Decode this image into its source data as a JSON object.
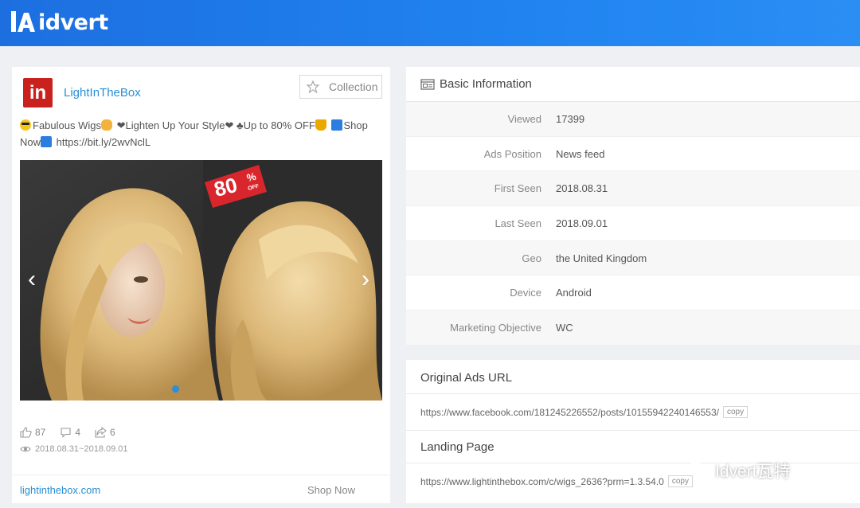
{
  "header": {
    "logo_text": "idvert"
  },
  "ad": {
    "advertiser_name": "LightInTheBox",
    "avatar_text": "in",
    "collection_label": "Collection",
    "text_part1": "Fabulous Wigs",
    "text_part2": "❤Lighten Up Your Style❤ ♣Up to 80% OFF",
    "text_part3": "Shop",
    "text_part4": "Now",
    "text_part5": "https://bit.ly/2wvNclL",
    "image_badge_big": "80",
    "image_badge_pct": "%",
    "image_badge_off": "OFF",
    "likes": "87",
    "comments": "4",
    "shares": "6",
    "date_range": "2018.08.31~2018.09.01",
    "domain": "lightinthebox.com",
    "cta": "Shop Now",
    "prev_arrow": "‹",
    "next_arrow": "›"
  },
  "basic_info": {
    "title": "Basic Information",
    "rows": [
      {
        "key": "Viewed",
        "value": "17399"
      },
      {
        "key": "Ads Position",
        "value": "News feed"
      },
      {
        "key": "First Seen",
        "value": "2018.08.31"
      },
      {
        "key": "Last Seen",
        "value": "2018.09.01"
      },
      {
        "key": "Geo",
        "value": "the United Kingdom"
      },
      {
        "key": "Device",
        "value": "Android"
      },
      {
        "key": "Marketing Objective",
        "value": "WC"
      }
    ]
  },
  "original_url": {
    "title": "Original Ads URL",
    "url": "https://www.facebook.com/181245226552/posts/10155942240146553/",
    "copy_label": "copy"
  },
  "landing_page": {
    "title": "Landing Page",
    "url": "https://www.lightinthebox.com/c/wigs_2636?prm=1.3.54.0",
    "copy_label": "copy"
  },
  "watermark": {
    "text": "Idvert瓦特"
  },
  "colors": {
    "header_blue": "#1d6fe0",
    "link_blue": "#2a8fd4",
    "brand_red": "#c9211e"
  }
}
